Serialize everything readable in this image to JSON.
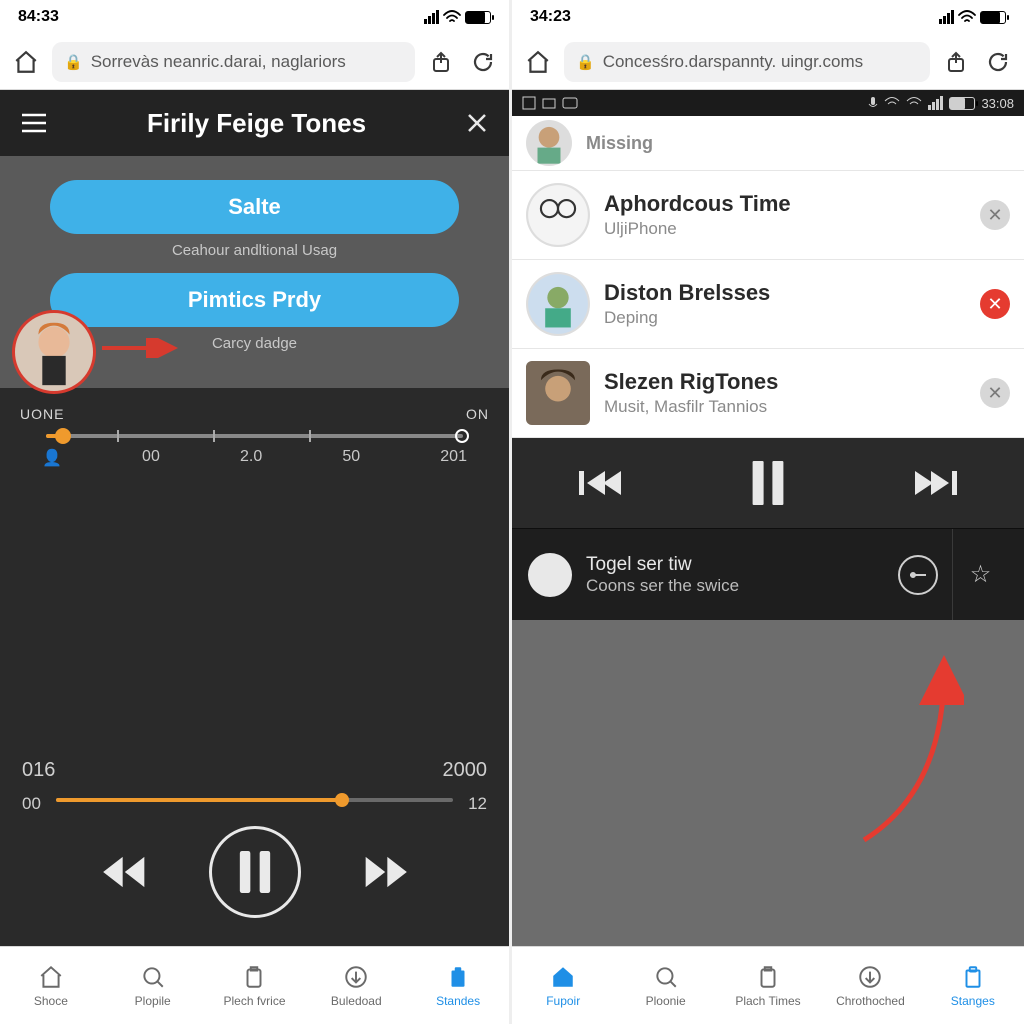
{
  "left": {
    "status_time": "84:33",
    "url": "Sorrevàs neanric.darai, naglariors",
    "header_title": "Firily Feige Tones",
    "button_primary": "Salte",
    "subtext1": "Ceahour andltional Usag",
    "button_secondary": "Pimtics Prdy",
    "subtext2": "Carcy dadge",
    "slider_left_label": "UONE",
    "slider_right_label": "ON",
    "ticks": {
      "a": "00",
      "b": "2.0",
      "c": "50",
      "d": "201"
    },
    "time_start": "016",
    "time_end": "2000",
    "progress_left": "00",
    "progress_right": "12",
    "tabs": [
      {
        "label": "Shoce"
      },
      {
        "label": "Plopile"
      },
      {
        "label": "Plech fvrice"
      },
      {
        "label": "Buledoad"
      },
      {
        "label": "Standes"
      }
    ]
  },
  "right": {
    "status_time": "34:23",
    "url": "Concesśro.darspannty. uingr.coms",
    "android_time": "33:08",
    "rows": [
      {
        "title": "Missing",
        "sub": ""
      },
      {
        "title": "Aphordcous Time",
        "sub": "UljiPhone"
      },
      {
        "title": "Diston Brelsses",
        "sub": "Deping"
      },
      {
        "title": "Slezen RigTones",
        "sub": "Musit, Masfilr Tannios"
      }
    ],
    "nowplaying_a": "Togel ser tiw",
    "nowplaying_b": "Coons ser the swice",
    "tabs": [
      {
        "label": "Fupoir"
      },
      {
        "label": "Ploonie"
      },
      {
        "label": "Plach Times"
      },
      {
        "label": "Chrothoched"
      },
      {
        "label": "Stanges"
      }
    ]
  },
  "colors": {
    "accent_blue": "#3fb1e8",
    "accent_orange": "#ef9a2d",
    "dark": "#2a2a2a"
  }
}
